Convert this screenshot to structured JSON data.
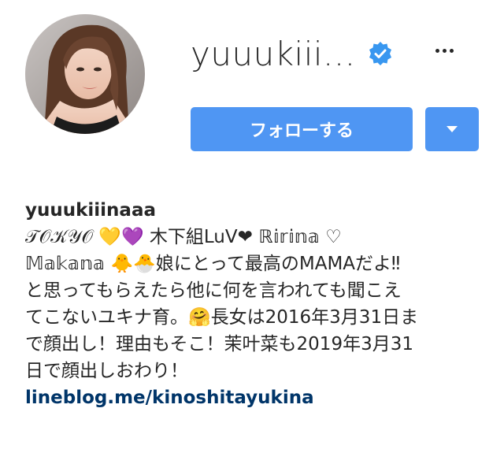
{
  "profile": {
    "username": "yuuukiii...",
    "verified": true,
    "follow_label": "フォローする",
    "more_icon": "more-horizontal-icon",
    "dropdown_icon": "caret-down-icon"
  },
  "bio": {
    "name": "yuuukiiinaaa",
    "lines": [
      "𝒯𝒪𝒦𝒴𝒪 💛💜 木下組LuV❤ ℝ𝕚𝕣𝕚𝕟𝕒 ♡",
      "𝕄𝕒𝕜𝕒𝕟𝕒 🐥🐣娘にとって最高のMAMAだよ‼",
      "と思ってもらえたら他に何を言われても聞こえ",
      "てこないユキナ育。🤗長女は2016年3月31日ま",
      "で顔出し！理由もそこ！茉叶菜も2019年3月31",
      "日で顔出しおわり！"
    ],
    "link": "lineblog.me/kinoshitayukina"
  },
  "colors": {
    "accent": "#4f96f3",
    "link": "#003569",
    "text": "#262626"
  }
}
